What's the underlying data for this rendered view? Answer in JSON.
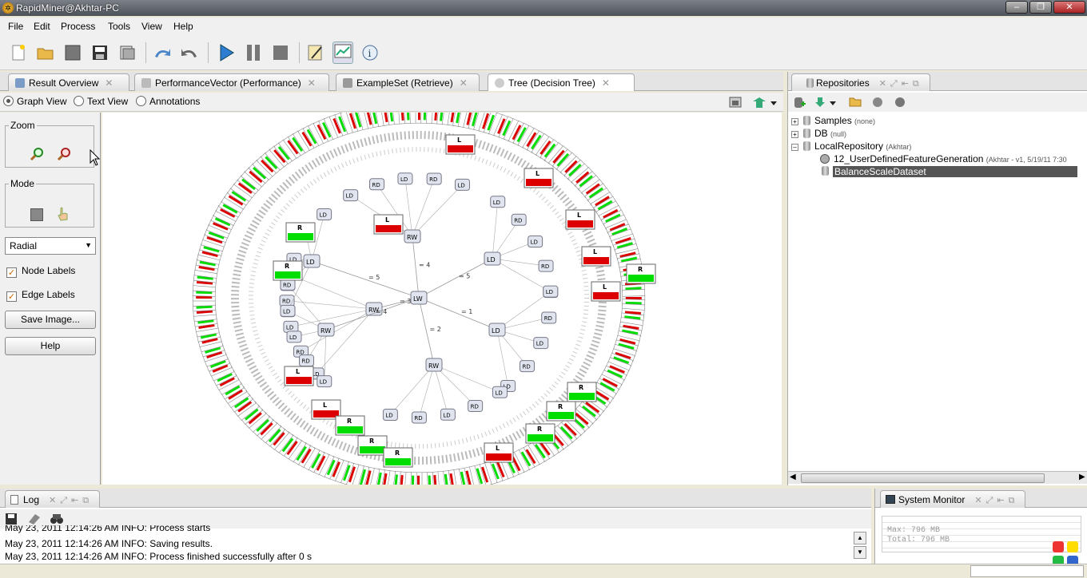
{
  "window": {
    "title": "RapidMiner@Akhtar-PC"
  },
  "menu": [
    "File",
    "Edit",
    "Process",
    "Tools",
    "View",
    "Help"
  ],
  "toolbar": {
    "icons": [
      "new-process-icon",
      "open-icon",
      "save-icon",
      "save-as-icon",
      "print-icon",
      "undo-icon",
      "redo-icon",
      "run-icon",
      "pause-icon",
      "stop-icon",
      "design-perspective-icon",
      "result-perspective-icon",
      "info-icon"
    ]
  },
  "tabs": [
    {
      "label": "Result Overview",
      "icon": "result-overview-icon"
    },
    {
      "label": "PerformanceVector (Performance)",
      "icon": "performance-icon"
    },
    {
      "label": "ExampleSet (Retrieve)",
      "icon": "exampleset-icon"
    },
    {
      "label": "Tree (Decision Tree)",
      "icon": "tree-icon"
    }
  ],
  "view_modes": {
    "graph": "Graph View",
    "text": "Text View",
    "annotations": "Annotations",
    "selected": "graph"
  },
  "left_panel": {
    "zoom_label": "Zoom",
    "mode_label": "Mode",
    "layout_select": "Radial",
    "node_labels": "Node Labels",
    "node_labels_checked": true,
    "edge_labels": "Edge Labels",
    "edge_labels_checked": true,
    "save_image": "Save Image...",
    "help": "Help"
  },
  "graph": {
    "root": "LW",
    "inner_nodes": [
      "RW",
      "LD",
      "LD",
      "RW",
      "RW",
      "RW"
    ],
    "edge_labels": [
      "= 4",
      "= 5",
      "= 1",
      "= 2",
      "= 3"
    ],
    "leaf_colors": {
      "R": "#00dd00",
      "L": "#dd0000",
      "B": "#000080"
    }
  },
  "repositories": {
    "title": "Repositories",
    "items": [
      {
        "name": "Samples",
        "meta": "(none)",
        "expanded": false
      },
      {
        "name": "DB",
        "meta": "(null)",
        "expanded": false
      },
      {
        "name": "LocalRepository",
        "meta": "(Akhtar)",
        "expanded": true
      },
      {
        "name": "12_UserDefinedFeatureGeneration",
        "meta": "(Akhtar - v1, 5/19/11 7:30"
      },
      {
        "name": "BalanceScaleDataset",
        "meta": ""
      }
    ]
  },
  "log": {
    "title": "Log",
    "lines": [
      "May 23, 2011 12:14:26 AM INFO: Process starts",
      "May 23, 2011 12:14:26 AM INFO: Saving results.",
      "May 23, 2011 12:14:26 AM INFO: Process finished successfully after 0 s"
    ]
  },
  "system_monitor": {
    "title": "System Monitor",
    "max_label": "Max:",
    "max_value": "796 MB",
    "total_label": "Total:",
    "total_value": "796 MB"
  }
}
